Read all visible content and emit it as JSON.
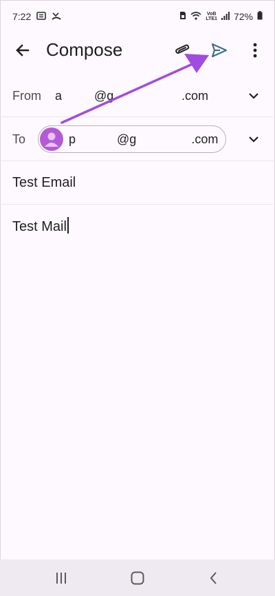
{
  "status_bar": {
    "time": "7:22",
    "battery": "72%",
    "icons": [
      "notification-icon",
      "missed-call-icon",
      "sim-icon",
      "wifi-icon",
      "volte-icon",
      "signal-icon",
      "battery-icon"
    ],
    "volte_line1": "VoB",
    "volte_line2": "LTE1"
  },
  "app_bar": {
    "title": "Compose",
    "icons": [
      "back-arrow-icon",
      "attach-icon",
      "send-icon",
      "more-vert-icon"
    ]
  },
  "from": {
    "label": "From",
    "value_start": "a",
    "value_mid": "@g",
    "value_end": ".com"
  },
  "to": {
    "label": "To",
    "chip_text": "p            @g                .com"
  },
  "subject": "Test Email",
  "body": "Test Mail",
  "colors": {
    "accent": "#a24be0",
    "send": "#3f6f8c",
    "avatar": "#b45ad6",
    "background": "#fdf9fe",
    "nav": "#efeaf1"
  },
  "nav_bar": {
    "icons": [
      "recents-icon",
      "home-icon",
      "nav-back-icon"
    ]
  }
}
